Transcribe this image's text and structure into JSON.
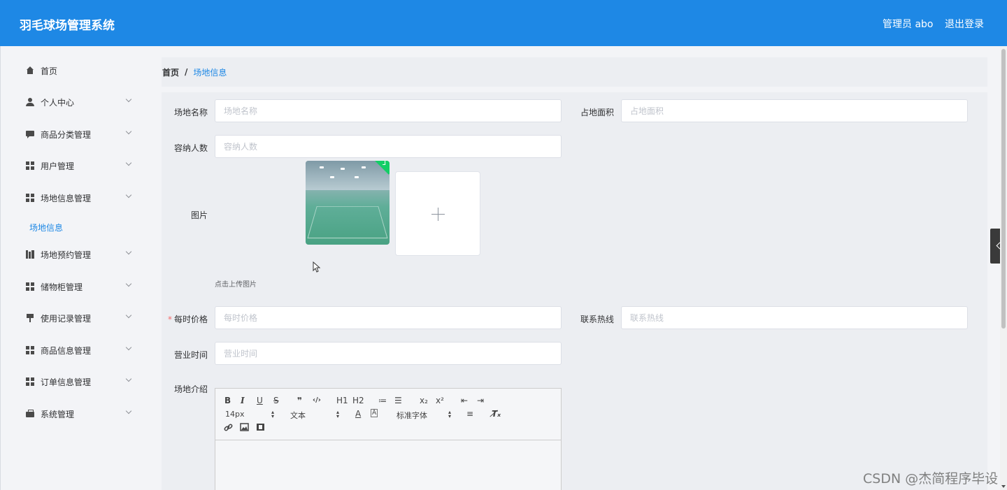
{
  "header": {
    "app_title": "羽毛球场管理系统",
    "user_label": "管理员 abo",
    "logout_label": "退出登录",
    "bg_color": "#1e88e5"
  },
  "sidebar": {
    "items": [
      {
        "label": "首页",
        "icon": "home-icon"
      },
      {
        "label": "个人中心",
        "icon": "user-icon"
      },
      {
        "label": "商品分类管理",
        "icon": "chat-icon"
      },
      {
        "label": "用户管理",
        "icon": "grid-icon"
      },
      {
        "label": "场地信息管理",
        "icon": "grid-icon"
      },
      {
        "label": "场地预约管理",
        "icon": "books-icon"
      },
      {
        "label": "储物柜管理",
        "icon": "grid-icon"
      },
      {
        "label": "使用记录管理",
        "icon": "brush-icon"
      },
      {
        "label": "商品信息管理",
        "icon": "grid-icon"
      },
      {
        "label": "订单信息管理",
        "icon": "grid-icon"
      },
      {
        "label": "系统管理",
        "icon": "briefcase-icon"
      }
    ],
    "active_sub": "场地信息"
  },
  "breadcrumb": {
    "home": "首页",
    "separator": "/",
    "current": "场地信息"
  },
  "form": {
    "venue_name": {
      "label": "场地名称",
      "placeholder": "场地名称"
    },
    "area": {
      "label": "占地面积",
      "placeholder": "占地面积"
    },
    "capacity": {
      "label": "容纳人数",
      "placeholder": "容纳人数"
    },
    "image": {
      "label": "图片",
      "upload_tip": "点击上传图片"
    },
    "price": {
      "required_mark": "*",
      "label": "每时价格",
      "placeholder": "每时价格"
    },
    "hotline": {
      "label": "联系热线",
      "placeholder": "联系热线"
    },
    "hours": {
      "label": "营业时间",
      "placeholder": "营业时间"
    },
    "intro": {
      "label": "场地介绍"
    }
  },
  "editor": {
    "buttons": [
      "B",
      "I",
      "U",
      "S",
      "❞",
      "‹/›",
      "H1",
      "H2",
      "≔",
      "☰",
      "x₂",
      "x²",
      "⇤",
      "⇥"
    ],
    "font_size": "14px",
    "text_style": "文本",
    "font_family": "标准字体",
    "row2_buttons": [
      "A",
      "Ā",
      "≡",
      "T̸ₓ"
    ],
    "row3_buttons": [
      "link",
      "image",
      "video"
    ]
  },
  "watermark": "CSDN @杰简程序毕设"
}
